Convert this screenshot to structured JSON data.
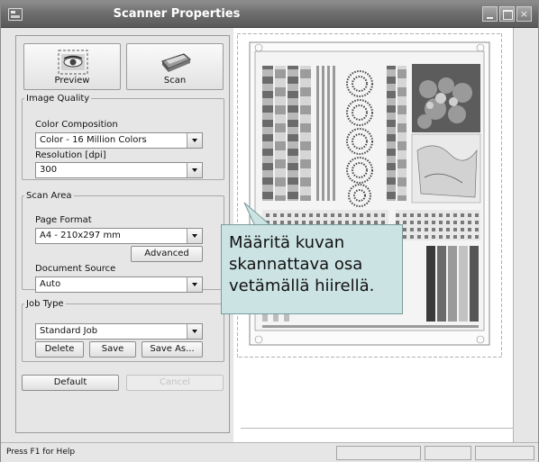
{
  "window": {
    "title": "Scanner Properties",
    "minimize_label": "_",
    "close_label": "×"
  },
  "toolbar": {
    "preview_label": "Preview",
    "scan_label": "Scan"
  },
  "image_quality": {
    "legend": "Image Quality",
    "color_label": "Color Composition",
    "color_value": "Color - 16 Million Colors",
    "resolution_label": "Resolution [dpi]",
    "resolution_value": "300"
  },
  "scan_area": {
    "legend": "Scan Area",
    "page_format_label": "Page Format",
    "page_format_value": "A4 - 210x297 mm",
    "advanced_label": "Advanced",
    "doc_source_label": "Document Source",
    "doc_source_value": "Auto"
  },
  "job_type": {
    "legend": "Job Type",
    "value": "Standard Job",
    "delete_label": "Delete",
    "save_label": "Save",
    "save_as_label": "Save As..."
  },
  "footer_buttons": {
    "default_label": "Default",
    "cancel_label": "Cancel"
  },
  "tooltip": {
    "line1": "Määritä kuvan",
    "line2": "skannattava osa",
    "line3": "vetämällä hiirellä."
  },
  "status": {
    "help_text": "Press F1 for Help"
  },
  "colors": {
    "tooltip_bg": "#cce3e3",
    "titlebar": "#6e6e6e",
    "window_bg": "#e6e6e6"
  }
}
